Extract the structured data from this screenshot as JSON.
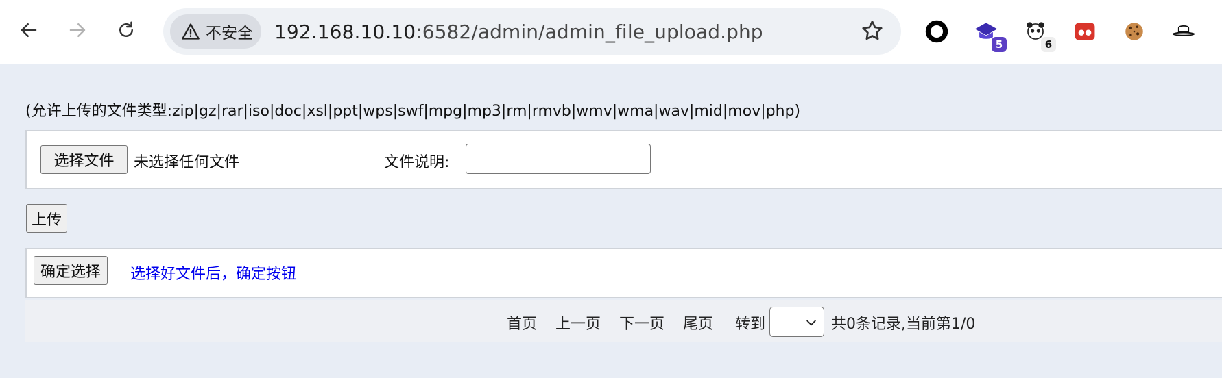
{
  "browser": {
    "security_label": "不安全",
    "url_host": "192.168.10.10",
    "url_path": ":6582/admin/admin_file_upload.php",
    "extensions": [
      {
        "icon": "circle-ring-extension-icon"
      },
      {
        "icon": "graduation-cap-extension-icon",
        "badge": "5"
      },
      {
        "icon": "panda-extension-icon",
        "badge": "6"
      },
      {
        "icon": "red-eyes-extension-icon"
      },
      {
        "icon": "cookie-extension-icon"
      },
      {
        "icon": "hat-extension-icon"
      }
    ]
  },
  "page": {
    "allowed_types": "(允许上传的文件类型:zip|gz|rar|iso|doc|xsl|ppt|wps|swf|mpg|mp3|rm|rmvb|wmv|wma|wav|mid|mov|php)",
    "upload_form": {
      "choose_file_label": "选择文件",
      "no_file_text": "未选择任何文件",
      "description_label": "文件说明:",
      "description_value": ""
    },
    "upload_button": "上传",
    "confirm": {
      "button_label": "确定选择",
      "hint_link": "选择好文件后，确定按钮"
    },
    "pager": {
      "first": "首页",
      "prev": "上一页",
      "next": "下一页",
      "last": "尾页",
      "goto": "转到",
      "selected_page": "",
      "summary": "共0条记录,当前第1/0"
    }
  }
}
